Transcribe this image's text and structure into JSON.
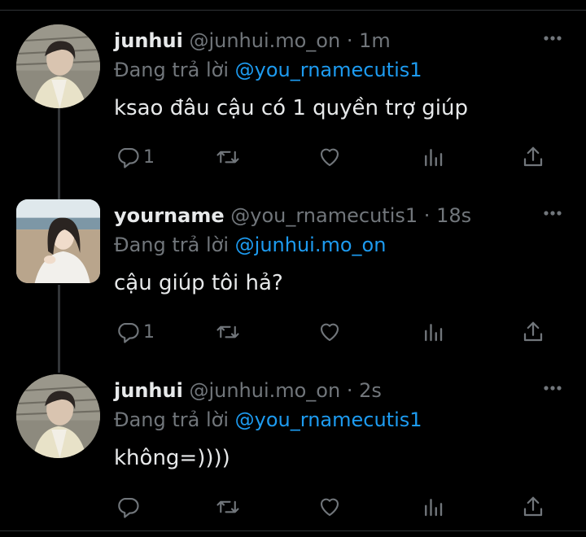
{
  "colors": {
    "background": "#000000",
    "text": "#e7e9ea",
    "muted": "#71767b",
    "accent": "#1d9bf0"
  },
  "tweets": [
    {
      "name": "junhui",
      "handle": "@junhui.mo_on",
      "separator": "·",
      "time": "1m",
      "reply_prefix": "Đang trả lời",
      "reply_to": "@you_rnamecutis1",
      "text": "ksao đâu cậu có 1 quyền trợ giúp",
      "reply_count": "1",
      "avatar_icon": "avatar-photo"
    },
    {
      "name": "yourname",
      "handle": "@you_rnamecutis1",
      "separator": "·",
      "time": "18s",
      "reply_prefix": "Đang trả lời",
      "reply_to": "@junhui.mo_on",
      "text": "cậu giúp tôi hả?",
      "reply_count": "1",
      "avatar_icon": "avatar-photo"
    },
    {
      "name": "junhui",
      "handle": "@junhui.mo_on",
      "separator": "·",
      "time": "2s",
      "reply_prefix": "Đang trả lời",
      "reply_to": "@you_rnamecutis1",
      "text": "không=))))",
      "reply_count": "",
      "avatar_icon": "avatar-photo"
    }
  ],
  "icons": {
    "reply": "reply-icon",
    "retweet": "retweet-icon",
    "like": "heart-icon",
    "analytics": "analytics-icon",
    "share": "share-icon",
    "more": "more-icon"
  }
}
